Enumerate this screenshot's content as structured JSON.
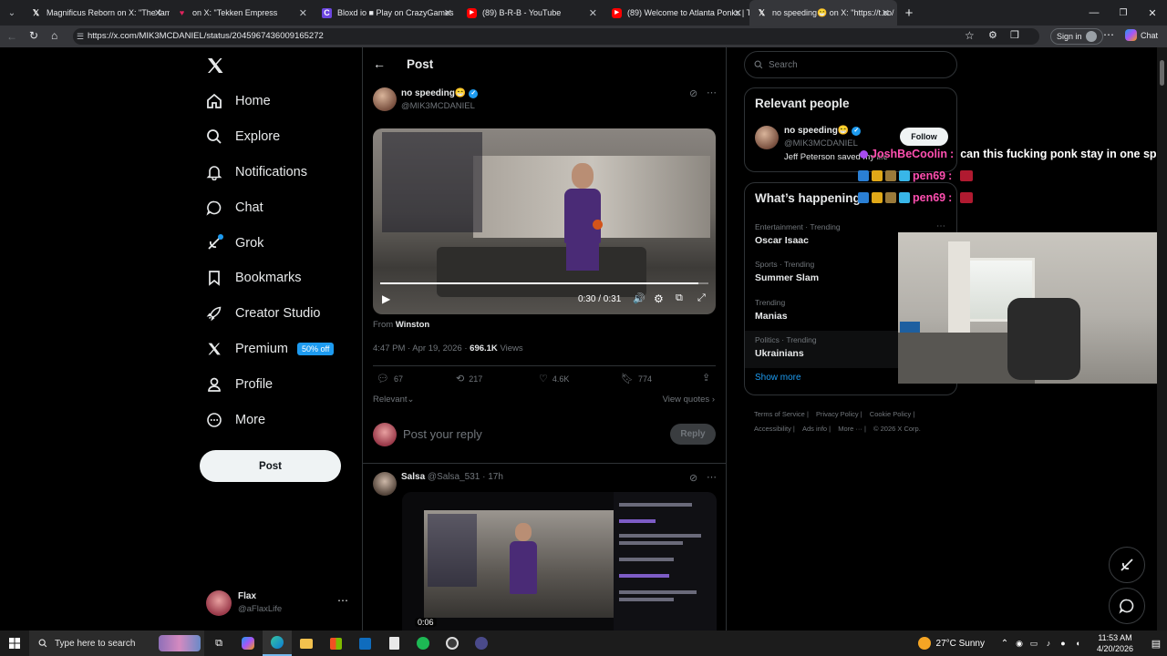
{
  "browser": {
    "tabs": [
      {
        "label": "Magnificus Reborn on X: \"The fam",
        "icon": "x-logo-icon"
      },
      {
        "label": "on X: \"Tekken Empress",
        "icon": "heart-icon"
      },
      {
        "label": "Bloxd io ■ Play on CrazyGames",
        "icon": "crazygames-icon"
      },
      {
        "label": "(89) B-R-B - YouTube",
        "icon": "youtube-icon"
      },
      {
        "label": "(89) Welcome to Atlanta Ponks | Th",
        "icon": "youtube-icon"
      },
      {
        "label": "no speeding😁 on X: \"https://t.co/",
        "icon": "x-logo-icon"
      }
    ],
    "url": "https://x.com/MIK3MCDANIEL/status/2045967436009165272",
    "sign_in": "Sign in",
    "chat": "Chat"
  },
  "nav": {
    "items": [
      {
        "label": "Home",
        "icon": "home-icon"
      },
      {
        "label": "Explore",
        "icon": "search-icon"
      },
      {
        "label": "Notifications",
        "icon": "bell-icon"
      },
      {
        "label": "Chat",
        "icon": "chat-icon"
      },
      {
        "label": "Grok",
        "icon": "grok-icon"
      },
      {
        "label": "Bookmarks",
        "icon": "bookmark-icon"
      },
      {
        "label": "Creator Studio",
        "icon": "rocket-icon"
      },
      {
        "label": "Premium",
        "icon": "x-logo-icon"
      },
      {
        "label": "Profile",
        "icon": "person-icon"
      },
      {
        "label": "More",
        "icon": "more-circle-icon"
      }
    ],
    "premium_badge": "50% off",
    "post_button": "Post",
    "account": {
      "name": "Flax",
      "handle": "@aFlaxLife"
    }
  },
  "post": {
    "header": "Post",
    "author": "no speeding😁",
    "handle": "@MIK3MCDANIEL",
    "video_time": "0:30 / 0:31",
    "from_label": "From",
    "from_source": "Winston",
    "timestamp": "4:47 PM · Apr 19, 2026 ·",
    "views": "696.1K",
    "views_label": "Views",
    "replies": "67",
    "reposts": "217",
    "likes": "4.6K",
    "bookmarks": "774",
    "relevant": "Relevant",
    "view_quotes": "View quotes",
    "reply_placeholder": "Post your reply",
    "reply_button": "Reply"
  },
  "reply_post": {
    "author": "Salsa",
    "handle_time": "@Salsa_531 · 17h",
    "video_time": "0:06"
  },
  "sidebar": {
    "search_placeholder": "Search",
    "relevant_title": "Relevant people",
    "person": {
      "name": "no speeding😁",
      "handle": "@MIK3MCDANIEL",
      "bio": "Jeff Peterson saved my life",
      "follow": "Follow"
    },
    "happening_title": "What’s happening",
    "trends": [
      {
        "category": "Entertainment · Trending",
        "name": "Oscar Isaac"
      },
      {
        "category": "Sports · Trending",
        "name": "Summer Slam"
      },
      {
        "category": "Trending",
        "name": "Manias"
      },
      {
        "category": "Politics · Trending",
        "name": "Ukrainians"
      }
    ],
    "show_more": "Show more",
    "footer": [
      "Terms of Service",
      "Privacy Policy",
      "Cookie Policy",
      "Accessibility",
      "Ads info",
      "More ···",
      "© 2026 X Corp."
    ]
  },
  "stream_overlay": {
    "chat1_user": "JoshBeCoolin",
    "chat1_text": "can this fucking ponk stay in one spot",
    "chat2_user": "pen69",
    "chat3_user": "pen69"
  },
  "taskbar": {
    "search_placeholder": "Type here to search",
    "weather": "27°C  Sunny",
    "time": "11:53 AM",
    "date": "4/20/2026"
  },
  "colors": {
    "accent": "#1d9bf0",
    "background": "#000000",
    "border": "#2f3336",
    "muted": "#71767b"
  }
}
